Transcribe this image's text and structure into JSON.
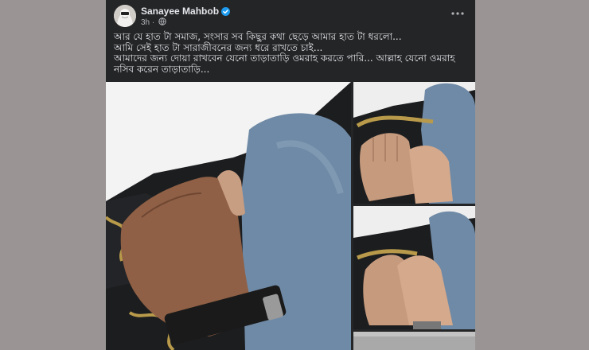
{
  "post": {
    "author": "Sanayee Mahbob",
    "verified": true,
    "time": "3h",
    "privacy_icon": "globe-icon",
    "more_icon": "more-options-icon",
    "text_lines": [
      "আর যে হাত টা সমাজ, সংসার সব কিছুর কথা ছেড়ে আমার হাত টা ধরলো...",
      "আমি সেই হাত টা সারাজীবনের জন্য ধরে রাখতে চাই...",
      "আমাদের জন্য দোয়া রাখবেন যেনো তাড়াতাড়ি ওমরাহ করতে পারি... আল্লাহ যেনো ওমরাহ নসিব করেন তাড়াতাড়ি..."
    ]
  },
  "colors": {
    "page_bg": "#9a9594",
    "card_bg": "#242526",
    "text_primary": "#e4e6eb",
    "text_secondary": "#b0b3b8",
    "verified_blue": "#1d9bf0"
  }
}
